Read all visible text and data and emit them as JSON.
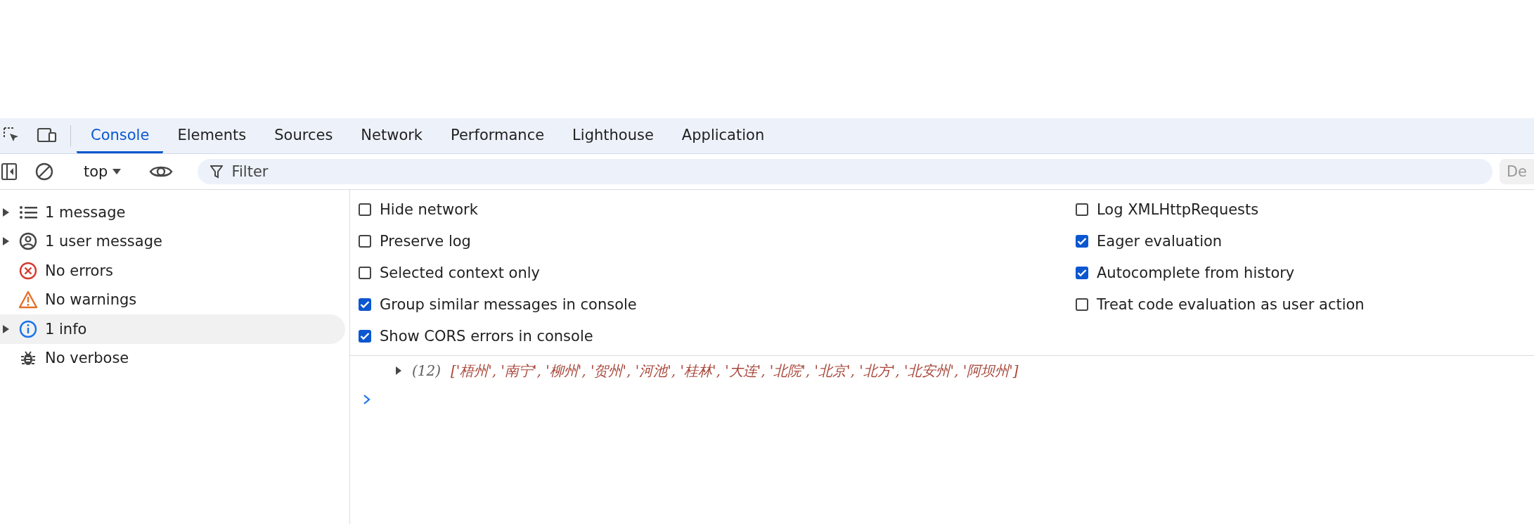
{
  "tabs": [
    {
      "label": "Console",
      "selected": true
    },
    {
      "label": "Elements",
      "selected": false
    },
    {
      "label": "Sources",
      "selected": false
    },
    {
      "label": "Network",
      "selected": false
    },
    {
      "label": "Performance",
      "selected": false
    },
    {
      "label": "Lighthouse",
      "selected": false
    },
    {
      "label": "Application",
      "selected": false
    }
  ],
  "toolbar": {
    "context": "top",
    "filter": {
      "placeholder": "Filter"
    },
    "levels_button": "De"
  },
  "sidebar": {
    "items": [
      {
        "kind": "list",
        "label": "1 message",
        "expandable": true,
        "selected": false
      },
      {
        "kind": "user",
        "label": "1 user message",
        "expandable": true,
        "selected": false
      },
      {
        "kind": "error",
        "label": "No errors",
        "expandable": false,
        "selected": false
      },
      {
        "kind": "warning",
        "label": "No warnings",
        "expandable": false,
        "selected": false
      },
      {
        "kind": "info",
        "label": "1 info",
        "expandable": true,
        "selected": true
      },
      {
        "kind": "verbose",
        "label": "No verbose",
        "expandable": false,
        "selected": false
      }
    ]
  },
  "settings": {
    "left": [
      {
        "label": "Hide network",
        "checked": false
      },
      {
        "label": "Preserve log",
        "checked": false
      },
      {
        "label": "Selected context only",
        "checked": false
      },
      {
        "label": "Group similar messages in console",
        "checked": true
      },
      {
        "label": "Show CORS errors in console",
        "checked": true
      }
    ],
    "right": [
      {
        "label": "Log XMLHttpRequests",
        "checked": false
      },
      {
        "label": "Eager evaluation",
        "checked": true
      },
      {
        "label": "Autocomplete from history",
        "checked": true
      },
      {
        "label": "Treat code evaluation as user action",
        "checked": false
      }
    ]
  },
  "console": {
    "entries": [
      {
        "count": "(12)",
        "preview": "['梧州', '南宁', '柳州', '贺州', '河池', '桂林', '大连', '北院', '北京', '北方', '北安州', '阿坝州']",
        "expanded": false
      }
    ]
  }
}
